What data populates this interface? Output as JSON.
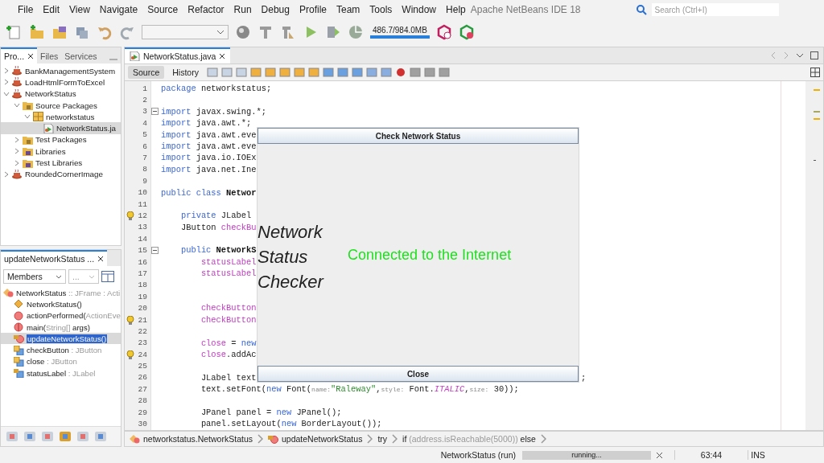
{
  "window": {
    "title": "Apache NetBeans IDE 18"
  },
  "menu": [
    "File",
    "Edit",
    "View",
    "Navigate",
    "Source",
    "Refactor",
    "Run",
    "Debug",
    "Profile",
    "Team",
    "Tools",
    "Window",
    "Help"
  ],
  "search": {
    "placeholder": "Search (Ctrl+I)"
  },
  "memory": {
    "reading": "486.7/984.0MB"
  },
  "projects_panel": {
    "tabs": [
      {
        "label": "Pro...",
        "selected": true,
        "closable": true
      },
      {
        "label": "Files",
        "selected": false,
        "closable": false
      },
      {
        "label": "Services",
        "selected": false,
        "closable": false
      }
    ],
    "tree": [
      {
        "label": "BankManagementSystem",
        "kind": "project",
        "expanded": false,
        "selected": false
      },
      {
        "label": "LoadHtmlFormToExcel",
        "kind": "project",
        "expanded": false,
        "selected": false
      },
      {
        "label": "NetworkStatus",
        "kind": "project",
        "expanded": true,
        "selected": false,
        "children": [
          {
            "label": "Source Packages",
            "kind": "folder",
            "expanded": true,
            "selected": false,
            "children": [
              {
                "label": "networkstatus",
                "kind": "package",
                "expanded": true,
                "selected": false,
                "children": [
                  {
                    "label": "NetworkStatus.ja",
                    "kind": "file",
                    "selected": true
                  }
                ]
              }
            ]
          },
          {
            "label": "Test Packages",
            "kind": "folder",
            "expanded": false,
            "selected": false
          },
          {
            "label": "Libraries",
            "kind": "library",
            "expanded": false,
            "selected": false
          },
          {
            "label": "Test Libraries",
            "kind": "library",
            "expanded": false,
            "selected": false
          }
        ]
      },
      {
        "label": "RoundedCornerImage",
        "kind": "project",
        "expanded": false,
        "selected": false
      }
    ]
  },
  "navigator": {
    "tab": "updateNetworkStatus ...",
    "filter": "Members",
    "filter_2": "...",
    "root": {
      "name": "NetworkStatus",
      "detail": " :: JFrame : Acti"
    },
    "members": [
      {
        "name": "NetworkStatus()",
        "kind": "constructor",
        "selected": false
      },
      {
        "name": "actionPerformed(",
        "detail": "ActionEve",
        "kind": "method",
        "selected": false
      },
      {
        "name": "main(",
        "detail": "String[]",
        "suffix": " args)",
        "kind": "static",
        "selected": false
      },
      {
        "name": "updateNetworkStatus()",
        "kind": "private-method",
        "selected": true
      },
      {
        "name": "checkButton",
        "detail": " : JButton",
        "kind": "field",
        "selected": false
      },
      {
        "name": "close",
        "detail": " : JButton",
        "kind": "field",
        "selected": false
      },
      {
        "name": "statusLabel",
        "detail": " : JLabel",
        "kind": "private-field",
        "selected": false
      }
    ]
  },
  "editor": {
    "tab": "NetworkStatus.java",
    "modes": [
      {
        "label": "Source",
        "selected": true
      },
      {
        "label": "History",
        "selected": false
      }
    ],
    "lines": [
      {
        "number": "1",
        "segments": [
          {
            "kind": "keyword",
            "text": "package"
          },
          {
            "kind": "plain",
            "text": " networkstatus;"
          }
        ]
      },
      {
        "number": "2"
      },
      {
        "number": "3",
        "foldable": true,
        "segments": [
          {
            "kind": "keyword",
            "text": "import"
          },
          {
            "kind": "plain",
            "text": " javax.swing.*;"
          }
        ]
      },
      {
        "number": "4",
        "segments": [
          {
            "kind": "keyword",
            "text": "import"
          },
          {
            "kind": "plain",
            "text": " java.awt.*;"
          }
        ]
      },
      {
        "number": "5",
        "segments": [
          {
            "kind": "keyword",
            "text": "import"
          },
          {
            "kind": "plain",
            "text": " java.awt.eve"
          }
        ]
      },
      {
        "number": "6",
        "segments": [
          {
            "kind": "keyword",
            "text": "import"
          },
          {
            "kind": "plain",
            "text": " java.awt.eve"
          }
        ]
      },
      {
        "number": "7",
        "segments": [
          {
            "kind": "keyword",
            "text": "import"
          },
          {
            "kind": "plain",
            "text": " java.io.IOEx"
          }
        ]
      },
      {
        "number": "8",
        "segments": [
          {
            "kind": "keyword",
            "text": "import"
          },
          {
            "kind": "plain",
            "text": " java.net.Ine"
          }
        ]
      },
      {
        "number": "9"
      },
      {
        "number": "10",
        "segments": [
          {
            "kind": "keyword",
            "text": "public class "
          },
          {
            "kind": "bold",
            "text": "Networ"
          }
        ]
      },
      {
        "number": "11"
      },
      {
        "number": "12",
        "hint": true,
        "segments": [
          {
            "kind": "keyword",
            "text": "    private"
          },
          {
            "kind": "plain",
            "text": " JLabel"
          }
        ]
      },
      {
        "number": "13",
        "segments": [
          {
            "kind": "plain",
            "text": "    JButton "
          },
          {
            "kind": "field",
            "text": "checkBu"
          }
        ]
      },
      {
        "number": "14"
      },
      {
        "number": "15",
        "foldable": true,
        "segments": [
          {
            "kind": "keyword",
            "text": "    public "
          },
          {
            "kind": "bold",
            "text": "NetworkS"
          }
        ]
      },
      {
        "number": "16",
        "segments": [
          {
            "kind": "field",
            "text": "        statusLabel"
          }
        ]
      },
      {
        "number": "17",
        "segments": [
          {
            "kind": "field",
            "text": "        statusLabel"
          }
        ]
      },
      {
        "number": "18"
      },
      {
        "number": "19"
      },
      {
        "number": "20",
        "segments": [
          {
            "kind": "field",
            "text": "        checkButton"
          }
        ]
      },
      {
        "number": "21",
        "hint": true,
        "segments": [
          {
            "kind": "field",
            "text": "        checkButton"
          }
        ]
      },
      {
        "number": "22"
      },
      {
        "number": "23",
        "segments": [
          {
            "kind": "field",
            "text": "        close"
          },
          {
            "kind": "plain",
            "text": " = "
          },
          {
            "kind": "keyword",
            "text": "new"
          }
        ]
      },
      {
        "number": "24",
        "hint": true,
        "segments": [
          {
            "kind": "field",
            "text": "        close"
          },
          {
            "kind": "plain",
            "text": ".addAc"
          }
        ]
      },
      {
        "number": "25"
      },
      {
        "number": "26",
        "segments": [
          {
            "kind": "plain",
            "text": "        JLabel text"
          }
        ],
        "tail": ";"
      },
      {
        "number": "27",
        "segments": [
          {
            "kind": "plain",
            "text": "        text.setFont("
          },
          {
            "kind": "keyword",
            "text": "new"
          },
          {
            "kind": "plain",
            "text": " Font("
          },
          {
            "kind": "hint",
            "text": "name:"
          },
          {
            "kind": "string",
            "text": "\"Raleway\""
          },
          {
            "kind": "plain",
            "text": ","
          },
          {
            "kind": "hint",
            "text": "style:"
          },
          {
            "kind": "plain",
            "text": " Font."
          },
          {
            "kind": "constant",
            "text": "ITALIC"
          },
          {
            "kind": "plain",
            "text": ","
          },
          {
            "kind": "hint",
            "text": "size:"
          },
          {
            "kind": "plain",
            "text": " 30));"
          }
        ]
      },
      {
        "number": "28"
      },
      {
        "number": "29",
        "segments": [
          {
            "kind": "plain",
            "text": "        JPanel panel = "
          },
          {
            "kind": "keyword",
            "text": "new"
          },
          {
            "kind": "plain",
            "text": " JPanel();"
          }
        ]
      },
      {
        "number": "30",
        "segments": [
          {
            "kind": "plain",
            "text": "        panel.setLayout("
          },
          {
            "kind": "keyword",
            "text": "new"
          },
          {
            "kind": "plain",
            "text": " BorderLayout());"
          }
        ]
      }
    ],
    "breadcrumbs": [
      {
        "name": "networkstatus.NetworkStatus",
        "kind": "class"
      },
      {
        "name": "updateNetworkStatus",
        "kind": "method"
      },
      {
        "name": "try"
      },
      {
        "name": "if",
        "detail": " (address.isReachable(5000))",
        "suffix": " else"
      }
    ]
  },
  "app_window": {
    "check_button": "Check Network Status",
    "heading": [
      "Network",
      "Status",
      "Checker"
    ],
    "status": "Connected to the Internet",
    "close_button": "Close"
  },
  "status_bar": {
    "task": "NetworkStatus (run)",
    "progress": {
      "label": "running...",
      "level": 1
    },
    "position": "63:44",
    "mode": "INS"
  }
}
